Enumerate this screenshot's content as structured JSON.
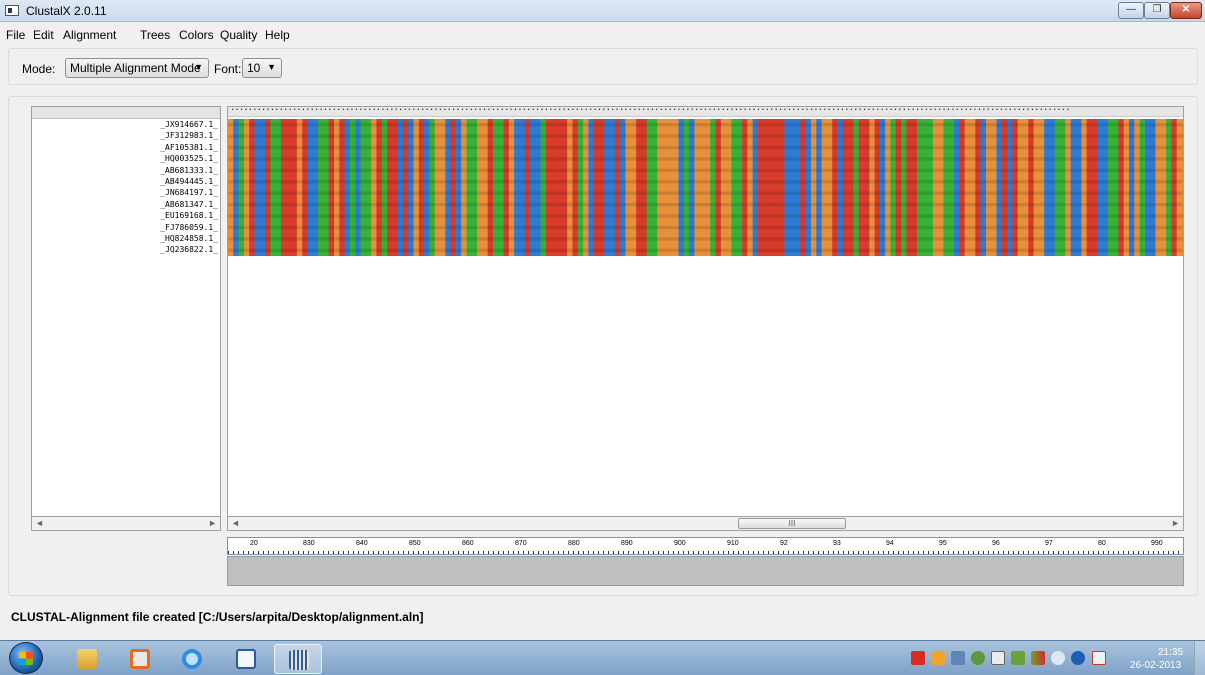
{
  "window": {
    "title": "ClustalX 2.0.11",
    "minimize_glyph": "—",
    "maximize_glyph": "❐",
    "close_glyph": "✕"
  },
  "menu": {
    "items": [
      "File",
      "Edit",
      "Alignment",
      "Trees",
      "Colors",
      "Quality",
      "Help"
    ]
  },
  "toolbar": {
    "mode_label": "Mode:",
    "mode_value": "Multiple Alignment Mode",
    "font_label": "Font:",
    "font_value": "10"
  },
  "sequences": {
    "names": [
      "_JX914667.1_",
      "_JF312983.1_",
      "_AF105381.1_",
      "_HQ003525.1_",
      "_AB681333.1_",
      "_AB494445.1_",
      "_JN684197.1_",
      "_AB681347.1_",
      "_EU169168.1_",
      "_FJ786059.1_",
      "_HQ824858.1_",
      "_JQ236822.1_"
    ],
    "base_colors": {
      "A": "#e8913a",
      "C": "#2e7bd6",
      "G": "#d93b2b",
      "T": "#36b336"
    },
    "segment": "ACTAGCCGTTGGGAGCCTTGAGCTCTTAGTGGCGCAGCTAACGCATTAAGTTGACCGCCTGGGGAGTACGGCCGCAAGGTTAAAACTCAAATGAATTGACGGGGGCCCGCACAAGCGGTGGAGCATGTGGTTTAATTCGAAGCAACGCGAAGAACCTTACCAGGCCTTGACATCCAATGAAT"
  },
  "scroll": {
    "left_arrow": "◄",
    "right_arrow": "►",
    "thumb_grip": "III"
  },
  "ruler": {
    "labels": [
      "20",
      "830",
      "840",
      "850",
      "860",
      "870",
      "880",
      "890",
      "900",
      "910",
      "92",
      "93",
      "94",
      "95",
      "96",
      "97",
      "80",
      "990"
    ]
  },
  "status": "CLUSTAL-Alignment file created  [C:/Users/arpita/Desktop/alignment.aln]",
  "clock": {
    "time": "21:35",
    "date": "26-02-2013"
  }
}
